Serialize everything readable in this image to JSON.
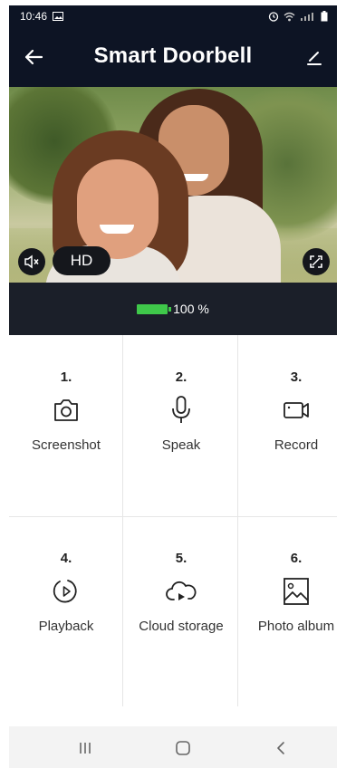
{
  "status_bar": {
    "time": "10:46",
    "left_icons": [
      "gallery-icon"
    ],
    "right_icons": [
      "alarm-icon",
      "wifi-icon",
      "signal-icon",
      "battery-icon"
    ]
  },
  "header": {
    "title": "Smart Doorbell",
    "back_icon": "arrow-left-icon",
    "edit_icon": "pencil-icon"
  },
  "video": {
    "quality_label": "HD",
    "mute_icon": "speaker-muted-icon",
    "fullscreen_icon": "fullscreen-icon"
  },
  "battery": {
    "label": "100 %",
    "level": 1.0,
    "color": "#3fc84a"
  },
  "actions": [
    {
      "number": "1.",
      "label": "Screenshot",
      "icon": "camera-icon"
    },
    {
      "number": "2.",
      "label": "Speak",
      "icon": "microphone-icon"
    },
    {
      "number": "3.",
      "label": "Record",
      "icon": "video-camera-icon"
    },
    {
      "number": "4.",
      "label": "Playback",
      "icon": "playback-icon"
    },
    {
      "number": "5.",
      "label": "Cloud storage",
      "icon": "cloud-play-icon"
    },
    {
      "number": "6.",
      "label": "Photo album",
      "icon": "image-icon"
    }
  ],
  "nav_bar": {
    "icons": [
      "recent-apps-icon",
      "home-icon",
      "back-icon"
    ]
  },
  "colors": {
    "header_bg": "#0d1424",
    "battery_strip_bg": "#1b1f29",
    "nav_bg": "#f3f3f3"
  }
}
